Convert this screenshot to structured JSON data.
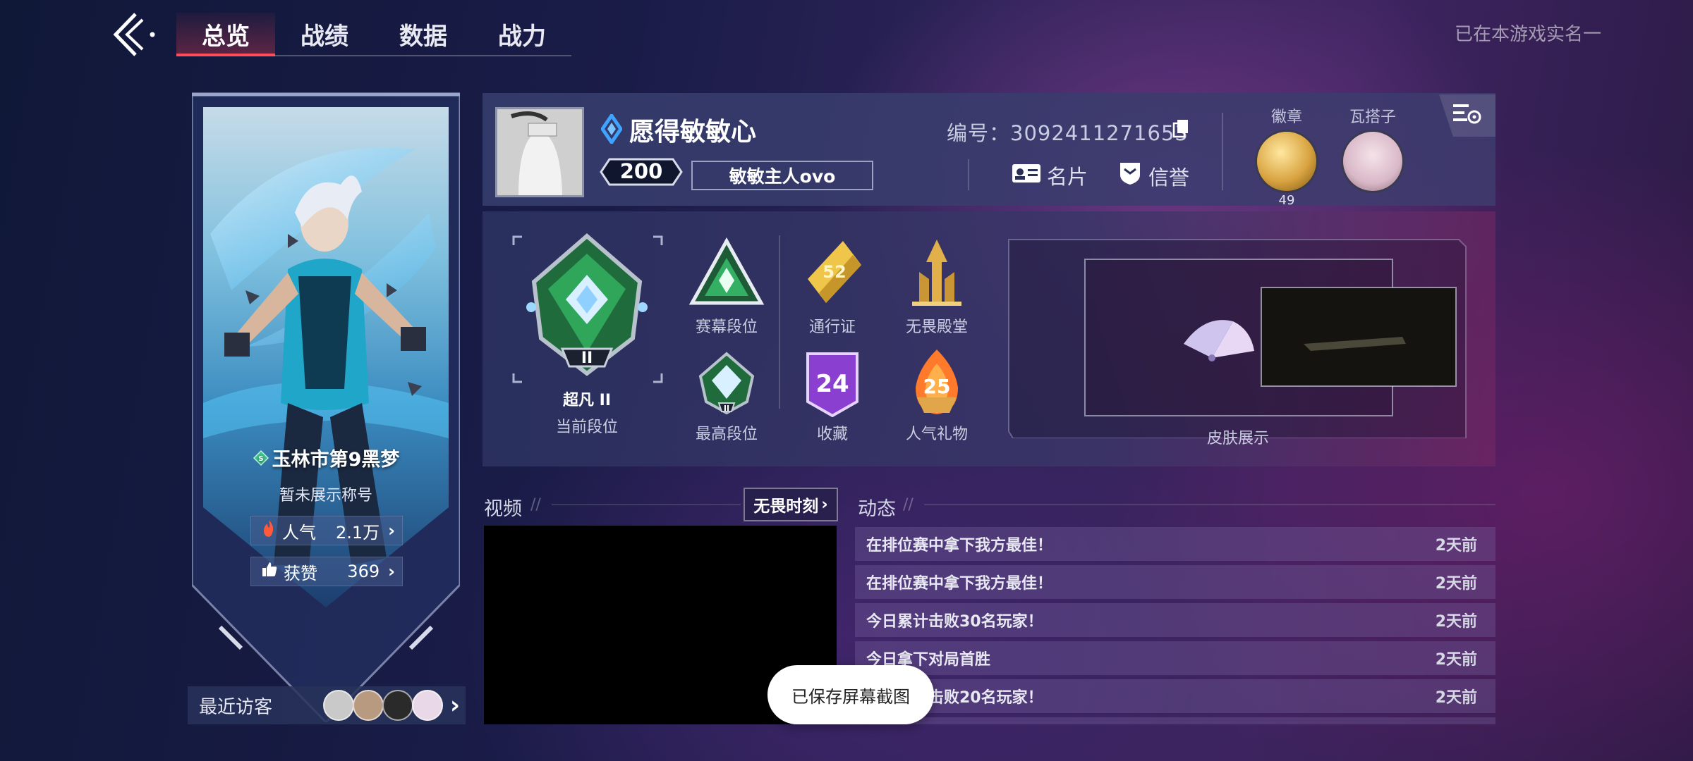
{
  "nav": {
    "tabs": [
      {
        "label": "总览",
        "active": true
      },
      {
        "label": "战绩",
        "active": false
      },
      {
        "label": "数据",
        "active": false
      },
      {
        "label": "战力",
        "active": false
      }
    ],
    "realname_text": "已在本游戏实名一"
  },
  "card": {
    "city_title": "玉林市第9黑梦",
    "display_title": "暂未展示称号",
    "popularity_label": "人气",
    "popularity_value": "2.1万",
    "likes_label": "获赞",
    "likes_value": "369",
    "visitors_label": "最近访客"
  },
  "profile": {
    "name": "愿得敏敏心",
    "level": "200",
    "clan": "敏敏主人ovo",
    "id_text": "编号：3092411271653",
    "namecard_label": "名片",
    "credit_label": "信誉",
    "badge_label": "徽章",
    "badge_count": "49",
    "partner_label": "瓦搭子"
  },
  "ranks": {
    "current_rank_name": "超凡 II",
    "current_rank_label": "当前段位",
    "rank_numeral": "II",
    "season_label": "赛幕段位",
    "highest_label": "最高段位",
    "highest_numeral": "II",
    "pass_label": "通行证",
    "pass_number": "52",
    "hall_label": "无畏殿堂",
    "collect_label": "收藏",
    "collect_number": "24",
    "gift_label": "人气礼物",
    "gift_number": "25",
    "skin_label": "皮肤展示"
  },
  "video": {
    "section_label": "视频",
    "fearless_label": "无畏时刻"
  },
  "feed": {
    "section_label": "动态",
    "items": [
      {
        "text": "在排位赛中拿下我方最佳！",
        "time": "2天前"
      },
      {
        "text": "在排位赛中拿下我方最佳！",
        "time": "2天前"
      },
      {
        "text": "今日累计击败30名玩家！",
        "time": "2天前"
      },
      {
        "text": "今日拿下对局首胜",
        "time": "2天前"
      },
      {
        "text": "今日累计击败20名玩家！",
        "time": "2天前"
      }
    ]
  },
  "toast": {
    "text": "已保存屏幕截图"
  },
  "colors": {
    "accent_red": "#ff4d5c",
    "rank_green": "#2fa65a",
    "collect_purple": "#8a3fd1",
    "gold": "#d9a441"
  }
}
